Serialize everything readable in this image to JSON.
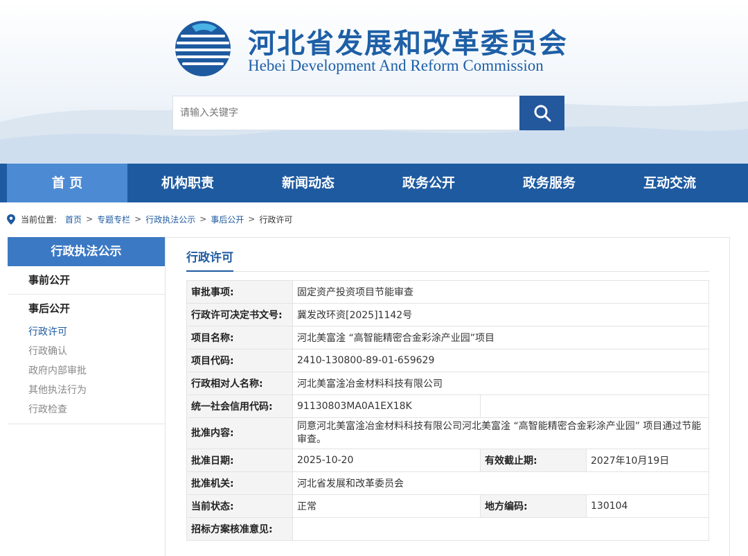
{
  "header": {
    "title_cn": "河北省发展和改革委员会",
    "title_en": "Hebei Development And Reform Commission",
    "search_placeholder": "请输入关键字"
  },
  "colors": {
    "brand": "#1e5aa0",
    "nav_active": "#4c8ad3",
    "sidebar_head": "#3c79c4"
  },
  "nav": {
    "items": [
      {
        "label": "首 页"
      },
      {
        "label": "机构职责"
      },
      {
        "label": "新闻动态"
      },
      {
        "label": "政务公开"
      },
      {
        "label": "政务服务"
      },
      {
        "label": "互动交流"
      }
    ]
  },
  "breadcrumb": {
    "label": "当前位置:",
    "items": [
      "首页",
      "专题专栏",
      "行政执法公示",
      "事后公开",
      "行政许可"
    ]
  },
  "sidebar": {
    "title": "行政执法公示",
    "group1": "事前公开",
    "group2": "事后公开",
    "sub": [
      "行政许可",
      "行政确认",
      "政府内部审批",
      "其他执法行为",
      "行政检查"
    ]
  },
  "main": {
    "title": "行政许可",
    "rows": {
      "item_k": "审批事项:",
      "item_v": "固定资产投资项目节能审查",
      "doc_k": "行政许可决定书文号:",
      "doc_v": "冀发改环资[2025]1142号",
      "name_k": "项目名称:",
      "name_v": "河北美富淦 “高智能精密合金彩涂产业园”项目",
      "code_k": "项目代码:",
      "code_v": "2410-130800-89-01-659629",
      "party_k": "行政相对人名称:",
      "party_v": "河北美富淦冶金材料科技有限公司",
      "credit_k": "统一社会信用代码:",
      "credit_v": "91130803MA0A1EX18K",
      "content_k": "批准内容:",
      "content_v": "同意河北美富淦冶金材料科技有限公司河北美富淦 “高智能精密合金彩涂产业园” 项目通过节能审查。",
      "date_k": "批准日期:",
      "date_v": "2025-10-20",
      "expire_k": "有效截止期:",
      "expire_v": "2027年10月19日",
      "org_k": "批准机关:",
      "org_v": "河北省发展和改革委员会",
      "status_k": "当前状态:",
      "status_v": "正常",
      "region_k": "地方编码:",
      "region_v": "130104",
      "bid_k": "招标方案核准意见:",
      "bid_v": ""
    }
  }
}
